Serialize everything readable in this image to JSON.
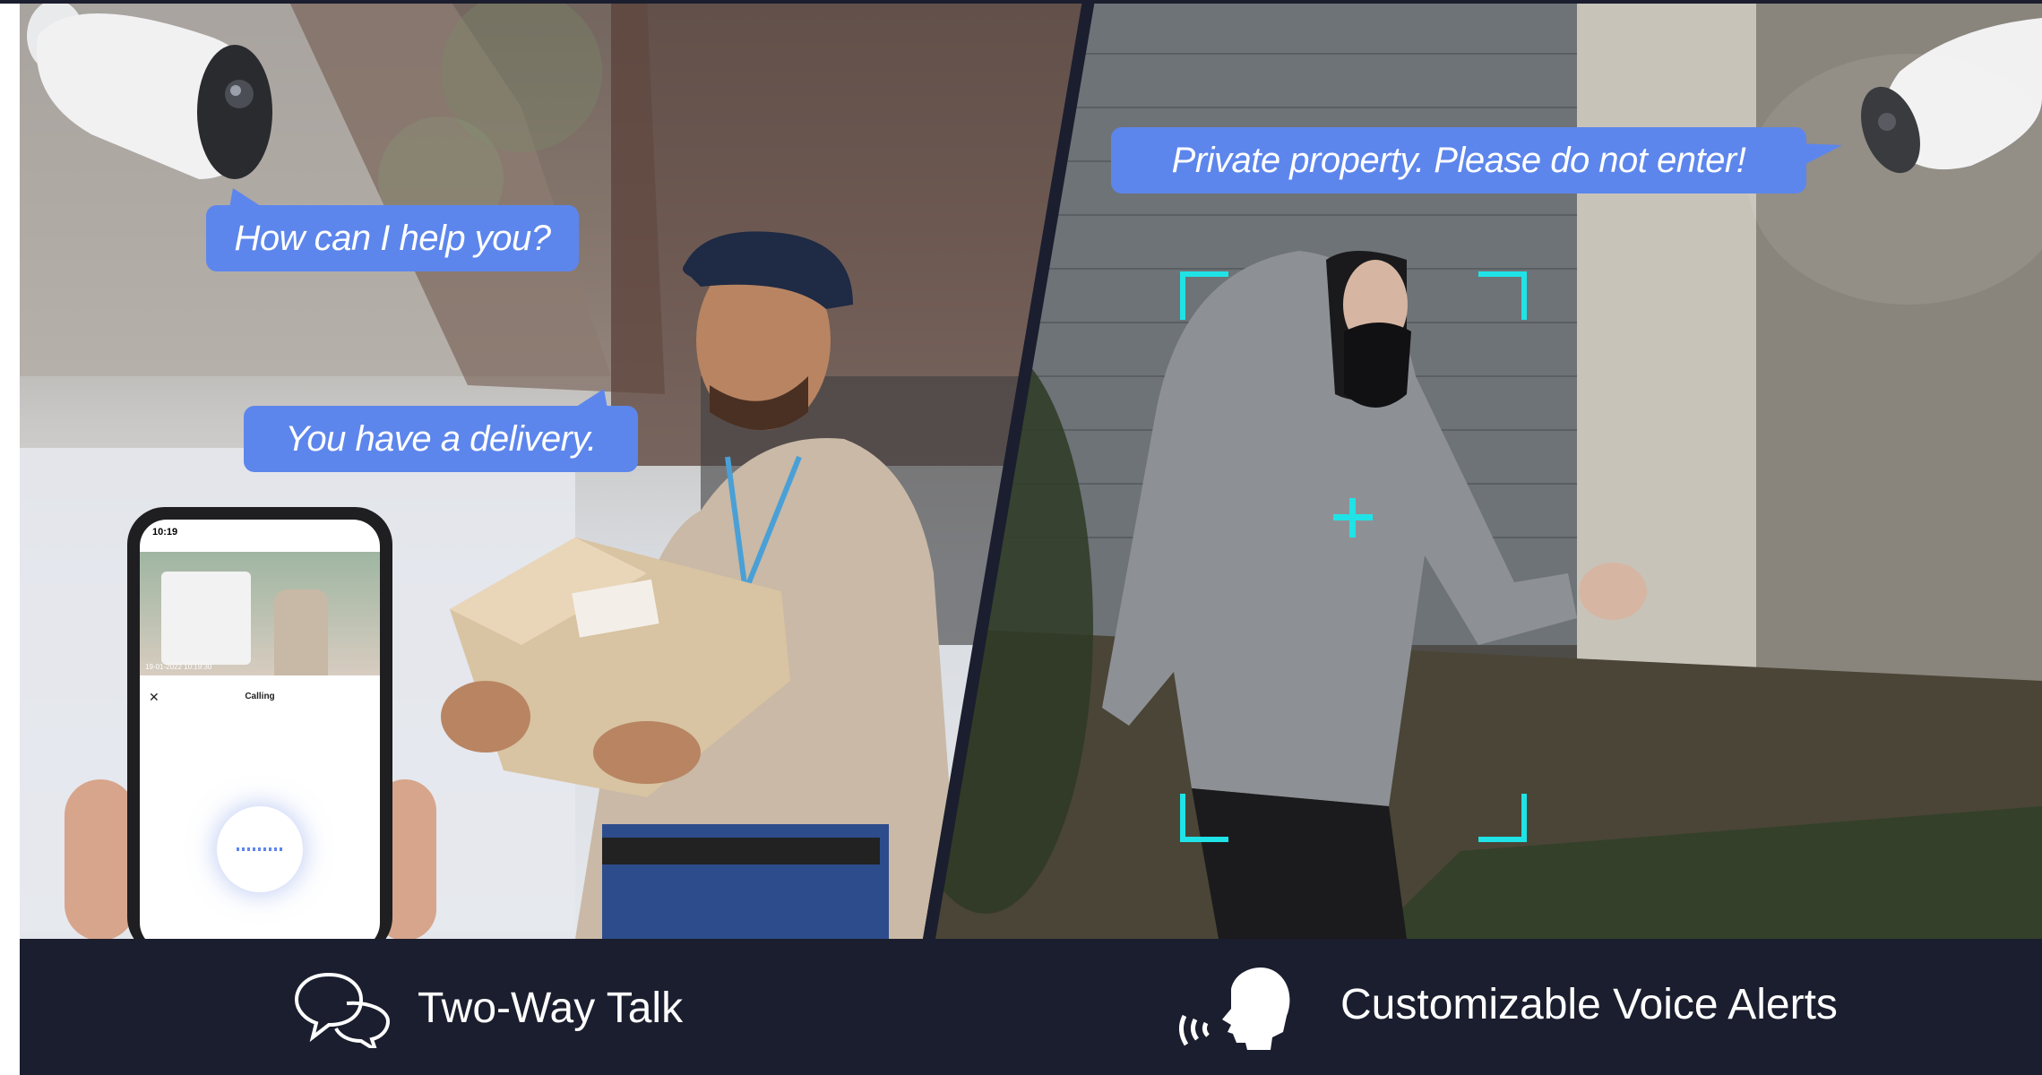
{
  "left_scene": {
    "bubble_help": "How can I help you?",
    "bubble_delivery": "You have a delivery."
  },
  "right_scene": {
    "bubble_alert": "Private property. Please do not enter!"
  },
  "phone": {
    "time": "10:19",
    "calling_label": "Calling",
    "timestamp": "19-01-2022 10:19:30"
  },
  "features": {
    "two_way_talk": "Two-Way Talk",
    "voice_alerts": "Customizable Voice Alerts"
  },
  "colors": {
    "bubble": "#5d86ec",
    "footer": "#1b1e2e",
    "detection_frame": "#1fe3e6"
  },
  "icons": {
    "two_way_talk": "chat-bubbles-icon",
    "voice_alerts": "speaking-head-icon"
  }
}
